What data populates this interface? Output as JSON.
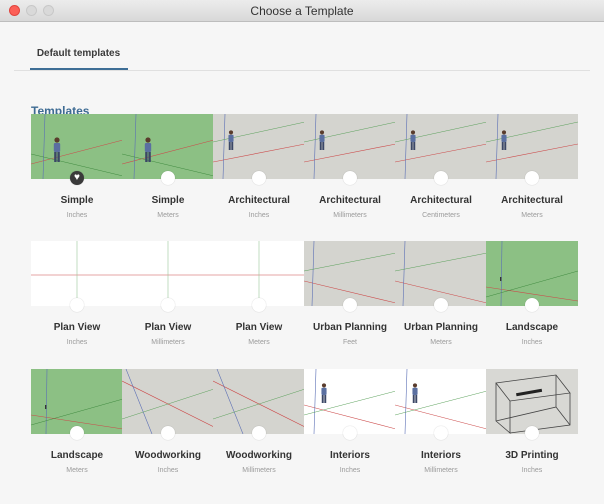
{
  "window": {
    "title": "Choose a Template"
  },
  "tabs": [
    {
      "label": "Default templates",
      "active": true
    }
  ],
  "section": {
    "title": "Templates"
  },
  "colors": {
    "accent": "#3e6e96",
    "close": "#fc5f57",
    "green_bg": "#8cc084",
    "gray_bg": "#d4d4cf"
  },
  "templates": [
    {
      "name": "Simple",
      "unit": "Inches",
      "thumb": "green-person",
      "favorite": true
    },
    {
      "name": "Simple",
      "unit": "Meters",
      "thumb": "green-person"
    },
    {
      "name": "Architectural",
      "unit": "Inches",
      "thumb": "gray-person"
    },
    {
      "name": "Architectural",
      "unit": "Millimeters",
      "thumb": "gray-person"
    },
    {
      "name": "Architectural",
      "unit": "Centimeters",
      "thumb": "gray-person"
    },
    {
      "name": "Architectural",
      "unit": "Meters",
      "thumb": "gray-person"
    },
    {
      "name": "Plan View",
      "unit": "Inches",
      "thumb": "white-plan"
    },
    {
      "name": "Plan View",
      "unit": "Millimeters",
      "thumb": "white-plan"
    },
    {
      "name": "Plan View",
      "unit": "Meters",
      "thumb": "white-plan"
    },
    {
      "name": "Urban Planning",
      "unit": "Feet",
      "thumb": "gray-lines"
    },
    {
      "name": "Urban Planning",
      "unit": "Meters",
      "thumb": "gray-lines"
    },
    {
      "name": "Landscape",
      "unit": "Inches",
      "thumb": "green-lines"
    },
    {
      "name": "Landscape",
      "unit": "Meters",
      "thumb": "green-lines"
    },
    {
      "name": "Woodworking",
      "unit": "Inches",
      "thumb": "gray-cross"
    },
    {
      "name": "Woodworking",
      "unit": "Millimeters",
      "thumb": "gray-cross"
    },
    {
      "name": "Interiors",
      "unit": "Inches",
      "thumb": "white-person"
    },
    {
      "name": "Interiors",
      "unit": "Millimeters",
      "thumb": "white-person"
    },
    {
      "name": "3D Printing",
      "unit": "Inches",
      "thumb": "print-box"
    }
  ]
}
